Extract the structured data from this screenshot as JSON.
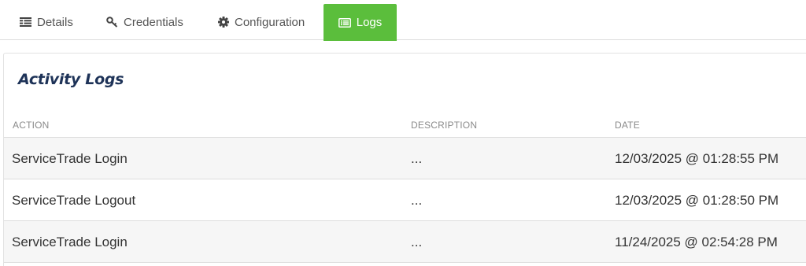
{
  "tabs": [
    {
      "label": "Details",
      "icon": "list-icon"
    },
    {
      "label": "Credentials",
      "icon": "key-icon"
    },
    {
      "label": "Configuration",
      "icon": "gear-icon"
    },
    {
      "label": "Logs",
      "icon": "logs-icon",
      "active": true
    }
  ],
  "colors": {
    "accent": "#5bbe3c",
    "title": "#1e3358"
  },
  "card": {
    "title": "Activity Logs",
    "columns": [
      "ACTION",
      "DESCRIPTION",
      "DATE"
    ],
    "rows": [
      {
        "action": "ServiceTrade Login",
        "description": "...",
        "date": "12/03/2025 @ 01:28:55 PM"
      },
      {
        "action": "ServiceTrade Logout",
        "description": "...",
        "date": "12/03/2025 @ 01:28:50 PM"
      },
      {
        "action": "ServiceTrade Login",
        "description": "...",
        "date": "11/24/2025 @ 02:54:28 PM"
      }
    ]
  }
}
